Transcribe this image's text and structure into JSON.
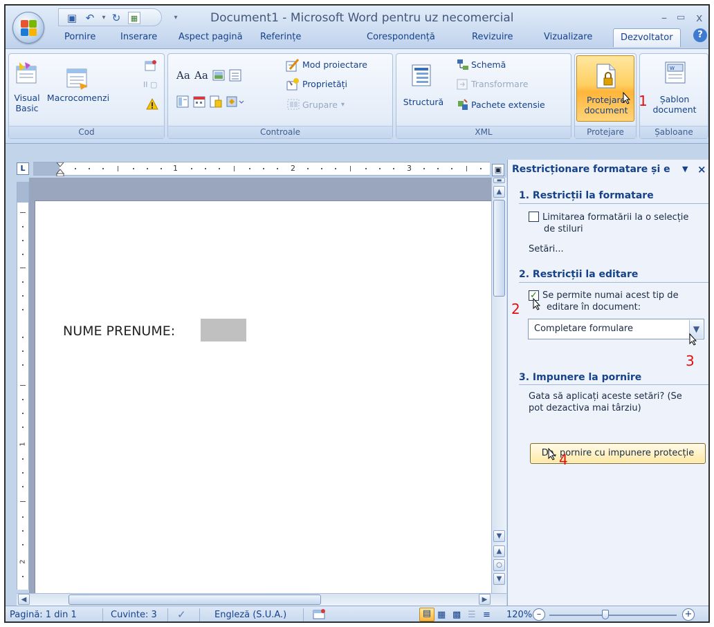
{
  "window": {
    "title": "Document1 - Microsoft Word pentru uz necomercial",
    "minimize": "–",
    "maximize": "▭",
    "close": "x"
  },
  "tabs": [
    "Pornire",
    "Inserare",
    "Aspect pagină",
    "Referințe",
    "Corespondență",
    "Revizuire",
    "Vizualizare",
    "Dezvoltator"
  ],
  "active_tab": "Dezvoltator",
  "ribbon": {
    "cod": {
      "label": "Cod",
      "visual_basic_line1": "Visual",
      "visual_basic_line2": "Basic",
      "macros": "Macrocomenzi"
    },
    "controale": {
      "label": "Controale",
      "design_mode": "Mod proiectare",
      "properties": "Proprietăți",
      "group": "Grupare"
    },
    "xml": {
      "label": "XML",
      "structure": "Structură",
      "schema": "Schemă",
      "transform": "Transformare",
      "expansion_packs": "Pachete extensie"
    },
    "protejare": {
      "label": "Protejare",
      "protect_line1": "Protejare",
      "protect_line2": "document"
    },
    "sabloane": {
      "label": "Șabloane",
      "template_line1": "Șablon",
      "template_line2": "document"
    }
  },
  "ruler": {
    "numbers": [
      "1",
      "2",
      "3"
    ],
    "vertical_numbers": [
      "1",
      "2"
    ]
  },
  "document": {
    "text": "NUME PRENUME:"
  },
  "pane": {
    "title": "Restricționare formatare și e",
    "menu_arrow": "▼",
    "close": "×",
    "section1": {
      "heading": "1. Restricții la formatare",
      "checkbox_label_line1": "Limitarea formatării la o selecție",
      "checkbox_label_line2": "de stiluri",
      "checked": false,
      "settings_link": "Setări..."
    },
    "section2": {
      "heading": "2. Restricții la editare",
      "checkbox_label_line1": "Se permite numai acest tip de",
      "checkbox_label_line2": "editare în document:",
      "checked": true,
      "dropdown_value": "Completare formulare"
    },
    "section3": {
      "heading": "3. Impunere la pornire",
      "text_line1": "Gata să aplicați aceste setări? (Se",
      "text_line2": "pot dezactiva mai târziu)",
      "button": "Da, pornire cu impunere protecție"
    }
  },
  "annotations": [
    "1",
    "2",
    "3",
    "4"
  ],
  "statusbar": {
    "page": "Pagină: 1 din 1",
    "words": "Cuvinte: 3",
    "language": "Engleză (S.U.A.)",
    "zoom": "120%",
    "zoom_out": "–",
    "zoom_in": "+"
  },
  "colors": {
    "accent": "#15428b",
    "annotation": "#e01010",
    "active_button": "#ffc64d"
  }
}
